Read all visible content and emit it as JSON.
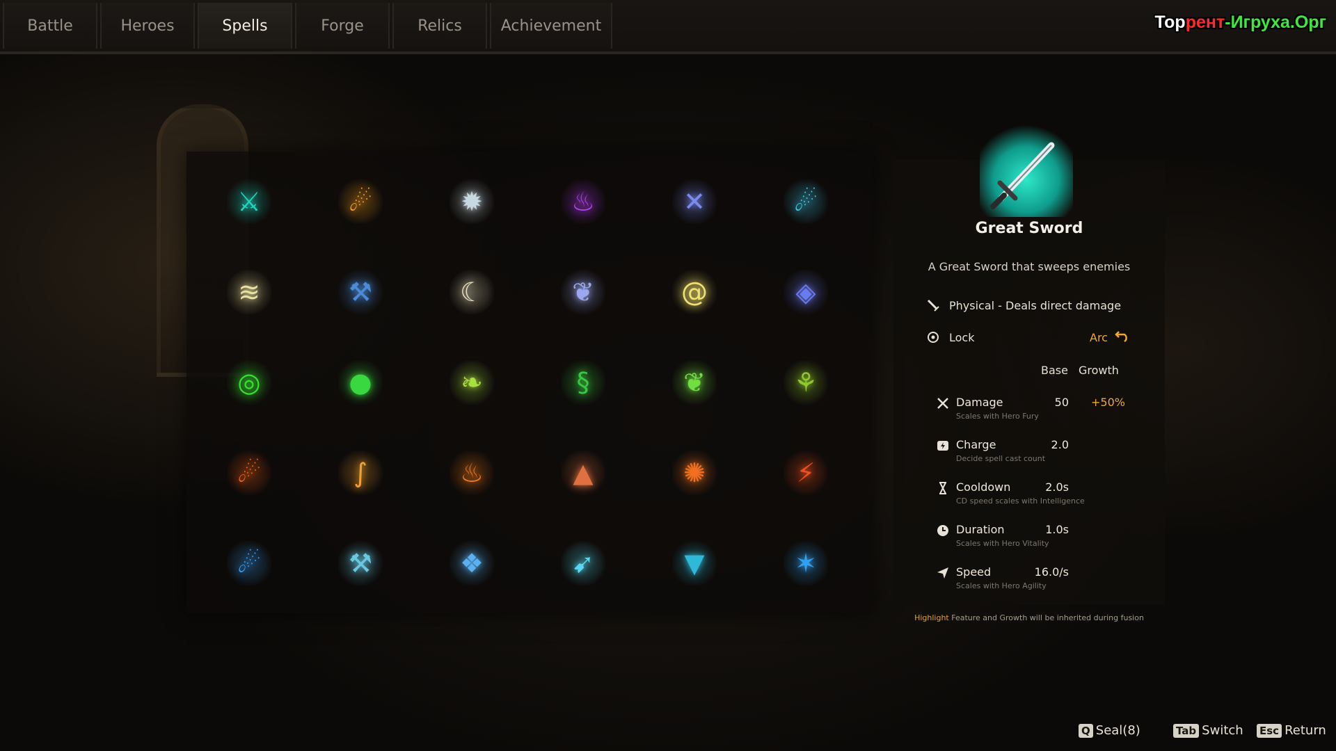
{
  "tabs": [
    {
      "label": "Battle"
    },
    {
      "label": "Heroes"
    },
    {
      "label": "Spells"
    },
    {
      "label": "Forge"
    },
    {
      "label": "Relics"
    },
    {
      "label": "Achievement"
    }
  ],
  "active_tab": "Spells",
  "watermark": {
    "part1": "Тор",
    "part2": "рент",
    "part3": "-Игруха",
    "part4": ".Орг"
  },
  "spells": [
    {
      "icon": "sword-icon",
      "color": "#1ed6c0"
    },
    {
      "icon": "fireball-icon",
      "color": "#f5a020"
    },
    {
      "icon": "shield-burst-icon",
      "color": "#c8d8e0"
    },
    {
      "icon": "purple-flames-icon",
      "color": "#b43ef0"
    },
    {
      "icon": "cross-slash-icon",
      "color": "#7a8af0"
    },
    {
      "icon": "purple-comet-icon",
      "color": "#40c8e8"
    },
    {
      "icon": "lightning-waves-icon",
      "color": "#e8e0a0"
    },
    {
      "icon": "hammer-icon",
      "color": "#4a8ad8"
    },
    {
      "icon": "crescent-icon",
      "color": "#e8e0c0"
    },
    {
      "icon": "wing-icon",
      "color": "#9aa8f0"
    },
    {
      "icon": "tornado-icon",
      "color": "#f0e070"
    },
    {
      "icon": "crystal-orb-icon",
      "color": "#6a7af0"
    },
    {
      "icon": "green-spiral-icon",
      "color": "#36e030"
    },
    {
      "icon": "green-orb-icon",
      "color": "#3ad840"
    },
    {
      "icon": "green-leaf-blade-icon",
      "color": "#a8e040"
    },
    {
      "icon": "cobra-icon",
      "color": "#38c840"
    },
    {
      "icon": "leaf-icon",
      "color": "#70e040"
    },
    {
      "icon": "vine-icon",
      "color": "#90c830"
    },
    {
      "icon": "fire-comet-icon",
      "color": "#f06018"
    },
    {
      "icon": "fire-whip-icon",
      "color": "#f0a030"
    },
    {
      "icon": "flame-wall-icon",
      "color": "#f07818"
    },
    {
      "icon": "fire-rocket-icon",
      "color": "#e07040"
    },
    {
      "icon": "fire-vortex-icon",
      "color": "#f07020"
    },
    {
      "icon": "fire-bolt-icon",
      "color": "#f05020"
    },
    {
      "icon": "ice-comet-icon",
      "color": "#3a9af0"
    },
    {
      "icon": "ice-axe-icon",
      "color": "#68c8e0"
    },
    {
      "icon": "ice-shards-icon",
      "color": "#5ab0f0"
    },
    {
      "icon": "ice-beam-icon",
      "color": "#58d8f0"
    },
    {
      "icon": "bat-icon",
      "color": "#30b8d8"
    },
    {
      "icon": "ice-claw-icon",
      "color": "#30a0f0"
    }
  ],
  "detail": {
    "name": "Great Sword",
    "description": "A Great Sword that sweeps enemies",
    "type_line": "Physical - Deals direct damage",
    "lock_label": "Lock",
    "arc_label": "Arc",
    "col_base": "Base",
    "col_growth": "Growth",
    "stats": [
      {
        "icon": "crossed-swords-icon",
        "name": "Damage",
        "sub": "Scales with Hero Fury",
        "base": "50",
        "growth": "+50%"
      },
      {
        "icon": "charge-icon",
        "name": "Charge",
        "sub": "Decide spell cast count",
        "base": "2.0",
        "growth": ""
      },
      {
        "icon": "hourglass-icon",
        "name": "Cooldown",
        "sub": "CD speed scales with Intelligence",
        "base": "2.0s",
        "growth": ""
      },
      {
        "icon": "clock-icon",
        "name": "Duration",
        "sub": "Scales with Hero Vitality",
        "base": "1.0s",
        "growth": ""
      },
      {
        "icon": "speed-icon",
        "name": "Speed",
        "sub": "Scales with Hero Agility",
        "base": "16.0/s",
        "growth": ""
      }
    ],
    "footnote_highlight": "Highlight",
    "footnote_rest": " Feature and Growth will be inherited during fusion"
  },
  "hints": [
    {
      "key": "Q",
      "label": "Seal(8)"
    },
    {
      "key": "Tab",
      "label": "Switch"
    },
    {
      "key": "Esc",
      "label": "Return"
    }
  ]
}
